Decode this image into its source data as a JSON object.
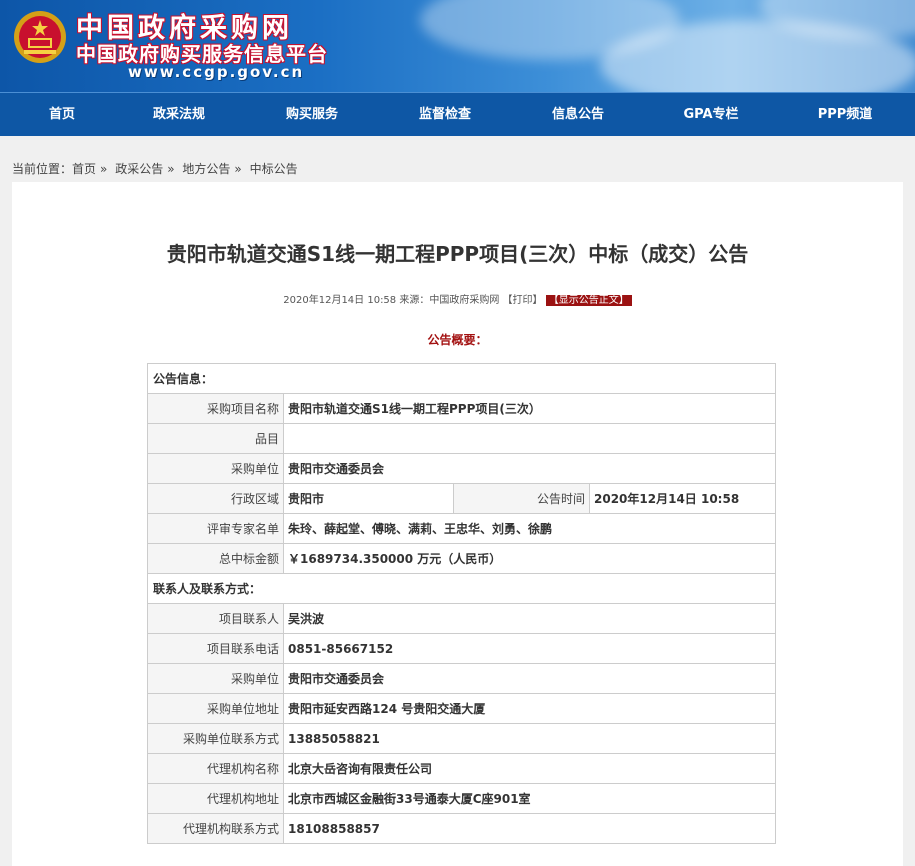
{
  "header": {
    "logo_line1": "中国政府采购网",
    "logo_line2": "中国政府购买服务信息平台",
    "logo_url": "www.ccgp.gov.cn"
  },
  "nav": {
    "items": [
      "首页",
      "政采法规",
      "购买服务",
      "监督检查",
      "信息公告",
      "GPA专栏",
      "PPP频道"
    ]
  },
  "breadcrumb": {
    "prefix": "当前位置：",
    "items": [
      "首页",
      "政采公告",
      "地方公告",
      "中标公告"
    ],
    "separator": "»"
  },
  "article": {
    "title": "贵阳市轨道交通S1线一期工程PPP项目(三次）中标（成交）公告",
    "meta_text": "2020年12月14日 10:58 来源：中国政府采购网",
    "print_label": "【打印】",
    "show_label": "【显示公告正文】",
    "summary_heading": "公告概要："
  },
  "table": {
    "section_info": "公告信息：",
    "project_name_label": "采购项目名称",
    "project_name": "贵阳市轨道交通S1线一期工程PPP项目(三次）",
    "item_label": "品目",
    "item_value": "",
    "purchaser_label": "采购单位",
    "purchaser": "贵阳市交通委员会",
    "region_label": "行政区域",
    "region": "贵阳市",
    "time_label": "公告时间",
    "time": "2020年12月14日 10:58",
    "experts_label": "评审专家名单",
    "experts": "朱玲、薛起堂、傅晓、满莉、王忠华、刘勇、徐鹏",
    "amount_label": "总中标金额",
    "amount": "￥1689734.350000 万元（人民币）",
    "section_contact": "联系人及联系方式：",
    "contact_person_label": "项目联系人",
    "contact_person": "吴洪波",
    "contact_phone_label": "项目联系电话",
    "contact_phone": "0851-85667152",
    "purchaser2_label": "采购单位",
    "purchaser2": "贵阳市交通委员会",
    "purchaser_addr_label": "采购单位地址",
    "purchaser_addr": "贵阳市延安西路124 号贵阳交通大厦",
    "purchaser_contact_label": "采购单位联系方式",
    "purchaser_contact": "13885058821",
    "agency_name_label": "代理机构名称",
    "agency_name": "北京大岳咨询有限责任公司",
    "agency_addr_label": "代理机构地址",
    "agency_addr": "北京市西城区金融街33号通泰大厦C座901室",
    "agency_contact_label": "代理机构联系方式",
    "agency_contact": "18108858857"
  },
  "colors": {
    "nav_bg": "#0e57a5",
    "accent_red": "#9b1212"
  }
}
